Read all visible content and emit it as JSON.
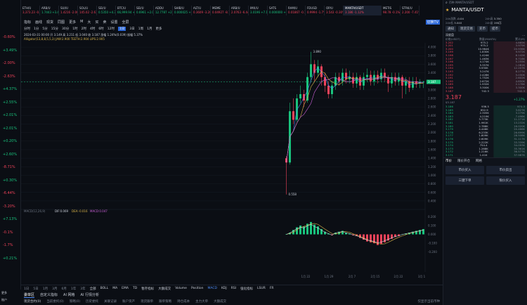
{
  "left_list": {
    "values": [
      "-0.60%",
      "+3.49%",
      "-2.00%",
      "-2.63%",
      "+4.37%",
      "+2.55%",
      "+2.01%",
      "+2.01%",
      "+0.20%",
      "+2.60%",
      "-8.71%",
      "+0.30%",
      "-6.44%",
      "-3.20%",
      "+7.13%",
      "-0.1%",
      "-1.7%",
      "+0.21%"
    ]
  },
  "ticker": [
    {
      "sym": "ETH/U",
      "px": "3,373.23",
      "chg": "-0.60%"
    },
    {
      "sym": "ARB/U",
      "px": "1.7443",
      "chg": "+3.49%"
    },
    {
      "sym": "SUI/U",
      "px": "1.4216",
      "chg": "-2.00%"
    },
    {
      "sym": "SOL/U",
      "px": "145.02",
      "chg": "-2.63%"
    },
    {
      "sym": "SEI/U",
      "px": "0.5350",
      "chg": "+4.37%"
    },
    {
      "sym": "BTC/U",
      "px": "66,999.94",
      "chg": "+2.55%"
    },
    {
      "sym": "SEI/U",
      "px": "0.6961",
      "chg": "+2.01%"
    },
    {
      "sym": "ADDU",
      "px": "12.7787",
      "chg": "+2.01%"
    },
    {
      "sym": "SHIB/U",
      "px": "0.000025",
      "chg": "+0.20%"
    },
    {
      "sym": "ALT/U",
      "px": "0.3609",
      "chg": "-3.20%"
    },
    {
      "sym": "MEME",
      "px": "0.04927",
      "chg": "-8.71%"
    },
    {
      "sym": "ARB/U",
      "px": "2.0763",
      "chg": "-6.44%"
    },
    {
      "sym": "IMX/U",
      "px": "3.0196",
      "chg": "+7.13%"
    },
    {
      "sym": "SATS",
      "px": "0.000000",
      "chg": "+0.21%"
    },
    {
      "sym": "RAM/U",
      "px": "0.01867",
      "chg": "-0.1%"
    },
    {
      "sym": "FDUSD",
      "px": "0.9994",
      "chg": "-1.7%"
    },
    {
      "sym": "OP/U",
      "px": "3.543",
      "chg": "-0.30%"
    },
    {
      "sym": "MANTA/USDT",
      "px": "3.186",
      "chg": "-1.12%"
    },
    {
      "sym": "METIS",
      "px": "98.78",
      "chg": "-0.1%"
    },
    {
      "sym": "STRK/U",
      "px": "2.200",
      "chg": "-7.41%"
    }
  ],
  "toolbar": {
    "items": [
      "指标",
      "画线",
      "现货",
      "同图",
      "更多",
      "M",
      "大",
      "买",
      "卖",
      "设置",
      "全屏"
    ],
    "right_btn": "切换TV"
  },
  "timeframes": {
    "items": [
      "分时",
      "1分",
      "5分",
      "15分",
      "30分",
      "1时",
      "2时",
      "4时",
      "6时",
      "12时",
      "1日",
      "3日",
      "1周",
      "1月",
      "更多"
    ],
    "selected": "1日"
  },
  "indicator_line": {
    "ohlc": "2024-03-31 00:00  开 3.149  高 3.211  低 3.040  收 3.187  涨幅 1.24%(0.039)  振幅 5.37%",
    "alligator": "Alligator(13,8,8,5,5,3)  JAW:2.900  TEETH:2.904  LIPS:2.905"
  },
  "chart_data": {
    "type": "candlestick",
    "x_ticks": [
      "1月 22",
      "1月 29",
      "2月 7",
      "2月 15",
      "2月 22",
      "3月 1"
    ],
    "y_ticks": [
      "4.000",
      "3.800",
      "3.600",
      "3.400",
      "3.200",
      "3.000",
      "2.800",
      "2.600",
      "2.400",
      "2.200",
      "2.000",
      "1.800",
      "1.600",
      "1.400",
      "1.200",
      "1.000",
      "0.800",
      "0.600",
      "0.400"
    ],
    "ylim": [
      0.3,
      4.1
    ],
    "last_price": "3.187",
    "annotations": [
      {
        "label": "3.890"
      },
      {
        "label": "0.558"
      }
    ],
    "candles": [
      [
        1.4,
        1.3,
        1.45,
        0.55
      ],
      [
        1.3,
        2.5,
        2.7,
        1.25
      ],
      [
        2.5,
        2.3,
        2.8,
        2.2
      ],
      [
        2.3,
        2.8,
        2.9,
        2.25
      ],
      [
        2.8,
        2.9,
        3.1,
        2.7
      ],
      [
        2.9,
        2.75,
        3.0,
        2.6
      ],
      [
        2.75,
        3.3,
        3.4,
        2.7
      ],
      [
        3.3,
        3.6,
        3.89,
        3.2
      ],
      [
        3.6,
        3.4,
        3.7,
        3.2
      ],
      [
        3.4,
        3.55,
        3.7,
        3.3
      ],
      [
        3.55,
        3.3,
        3.6,
        3.1
      ],
      [
        3.3,
        3.1,
        3.4,
        2.95
      ],
      [
        3.1,
        2.9,
        3.2,
        2.8
      ],
      [
        2.9,
        3.1,
        3.2,
        2.8
      ],
      [
        3.1,
        3.3,
        3.4,
        3.0
      ],
      [
        3.3,
        3.2,
        3.4,
        3.1
      ],
      [
        3.2,
        3.4,
        3.5,
        3.1
      ],
      [
        3.4,
        3.25,
        3.5,
        3.15
      ],
      [
        3.25,
        3.3,
        3.45,
        3.15
      ],
      [
        3.3,
        3.15,
        3.4,
        3.05
      ],
      [
        3.15,
        3.3,
        3.4,
        3.05
      ],
      [
        3.3,
        3.1,
        3.35,
        3.0
      ],
      [
        3.1,
        3.3,
        3.4,
        3.0
      ],
      [
        3.3,
        3.35,
        3.5,
        3.2
      ],
      [
        3.35,
        3.2,
        3.45,
        3.1
      ],
      [
        3.2,
        3.35,
        3.45,
        3.1
      ],
      [
        3.35,
        3.25,
        3.45,
        3.15
      ],
      [
        3.25,
        3.4,
        3.5,
        3.2
      ],
      [
        3.4,
        3.3,
        3.5,
        3.2
      ],
      [
        3.3,
        3.15,
        3.35,
        2.95
      ],
      [
        3.15,
        3.3,
        3.4,
        3.05
      ],
      [
        3.3,
        3.2,
        3.4,
        3.1
      ],
      [
        3.2,
        3.3,
        3.4,
        3.1
      ],
      [
        3.3,
        3.1,
        3.35,
        2.8
      ],
      [
        3.1,
        3.2,
        3.3,
        2.9
      ],
      [
        3.2,
        3.05,
        3.3,
        2.95
      ],
      [
        3.05,
        3.2,
        3.3,
        3.0
      ],
      [
        3.2,
        3.15,
        3.3,
        3.05
      ],
      [
        3.15,
        3.187,
        3.25,
        3.04
      ],
      [
        3.187,
        3.187,
        3.211,
        3.04
      ]
    ],
    "macd": {
      "label": "MACD(12,26,9)",
      "dif": "DIF:0.069",
      "dea": "DEA:-0.016",
      "macd": "MACD:0.047",
      "hist": [
        0.0,
        0.02,
        0.05,
        0.08,
        0.1,
        0.09,
        0.12,
        0.14,
        0.11,
        0.09,
        0.06,
        0.03,
        0.01,
        -0.01,
        0.02,
        0.03,
        0.04,
        0.02,
        0.01,
        -0.01,
        -0.02,
        -0.04,
        -0.06,
        -0.08,
        -0.09,
        -0.1,
        -0.12,
        -0.11,
        -0.09,
        -0.07,
        -0.05,
        -0.03,
        -0.02,
        0.0,
        0.01,
        0.02,
        0.03,
        0.04,
        0.05,
        0.06
      ],
      "y_ticks": [
        "0.200",
        "0.100",
        "0.000",
        "-0.100",
        "-0.200"
      ],
      "ylim": [
        -0.25,
        0.25
      ]
    }
  },
  "bottom_tabs": {
    "indicators": [
      "BOLL",
      "MA",
      "EMA",
      "TD",
      "暂存指标",
      "大额成交",
      "Volume",
      "Position",
      "MACD",
      "KDJ",
      "RSI",
      "强化指标",
      "LSUR",
      "FR"
    ],
    "selected_indicator": "MACD",
    "range_label": "全部",
    "ranges": [
      "1日",
      "5日",
      "1月",
      "3月",
      "6月",
      "1年",
      "3年",
      "全部"
    ],
    "row2": [
      "委单区",
      "自定义指标",
      "AI 网格",
      "AI 行情分析"
    ],
    "row3": [
      "现货合约(0)",
      "当前委托(0)",
      "策略(0)",
      "历史委托",
      "关联记录",
      "账户资产",
      "现货跟单",
      "跟单策略",
      "持仓成本",
      "主力大单",
      "大额成交"
    ],
    "notify_label": "仅显示当前币种"
  },
  "right_panel": {
    "search_placeholder": "币种 MANTA/USDT",
    "pair": "MANTA/USDT",
    "stats": [
      {
        "k": "24h涨跌",
        "v": "-0.04"
      },
      {
        "k": "24h高",
        "v": "3.350"
      },
      {
        "k": "24h低",
        "v": "3.040"
      },
      {
        "k": "24h量",
        "v": "198万"
      }
    ],
    "buttons": [
      "通知",
      "现货交易",
      "充币",
      "提币"
    ],
    "order_book_tab": "深度盘",
    "col_headers": [
      "价格(USDT)",
      "数量(MANTA)",
      "累计(M)"
    ],
    "asks": [
      [
        "3.202",
        "975.2",
        "4.865K"
      ],
      [
        "3.201",
        "975.2",
        "3.975K"
      ],
      [
        "3.200",
        "10.964K",
        "20.936K"
      ],
      [
        "3.199",
        "1.830K",
        "9.972K"
      ],
      [
        "3.198",
        "1.424K",
        "8.142K"
      ],
      [
        "3.197",
        "1.463K",
        "6.718K"
      ],
      [
        "3.196",
        "4.174K",
        "5.255K"
      ],
      [
        "3.195",
        "5.357K",
        "1.081K"
      ],
      [
        "3.194",
        "3.930K",
        "12.207K"
      ],
      [
        "3.193",
        "3.247K",
        "8.277K"
      ],
      [
        "3.192",
        "2.428K",
        "5.030K"
      ],
      [
        "3.191",
        "1.752K",
        "2.602K"
      ],
      [
        "3.190",
        "2.672K",
        "4.850K"
      ],
      [
        "3.189",
        "1.932K",
        "2.178K"
      ],
      [
        "3.188",
        "3.300K",
        "3.300K"
      ],
      [
        "3.187",
        "742.3",
        "742.3"
      ]
    ],
    "last_px": "3.187",
    "last_sub": "$3.187",
    "last_chg": "+1.27%",
    "bids": [
      [
        "3.186",
        "936.5",
        "974.3"
      ],
      [
        "3.185",
        "652.9",
        "3.627K"
      ],
      [
        "3.184",
        "2.305K",
        "3.279K"
      ],
      [
        "3.183",
        "4.219K",
        "7.498K"
      ],
      [
        "3.182",
        "3.773K",
        "11.271K"
      ],
      [
        "3.181",
        "1.961K",
        "13.232K"
      ],
      [
        "3.180",
        "2.788K",
        "16.020K"
      ],
      [
        "3.179",
        "4.446K",
        "20.466K"
      ],
      [
        "3.178",
        "6.233K",
        "26.699K"
      ],
      [
        "3.177",
        "1.809K",
        "28.508K"
      ],
      [
        "3.176",
        "2.609K",
        "31.117K"
      ],
      [
        "3.175",
        "2.222K",
        "33.339K"
      ],
      [
        "3.174",
        "754.4",
        "34.093K"
      ],
      [
        "3.173",
        "1.268K",
        "35.361K"
      ],
      [
        "3.172",
        "1.216K",
        "36.577K"
      ],
      [
        "3.171",
        "1.41K",
        "37.987K"
      ]
    ],
    "trade_tabs": [
      "市价",
      "限价开仓",
      "网格"
    ],
    "trade_btns": [
      "市价买入",
      "市价卖出",
      "三键下单",
      "限价买入"
    ],
    "watch_btn": "看涨",
    "watch_btn2": "看跌"
  },
  "bottom_left": {
    "label1": "更多",
    "label2": "账户"
  }
}
